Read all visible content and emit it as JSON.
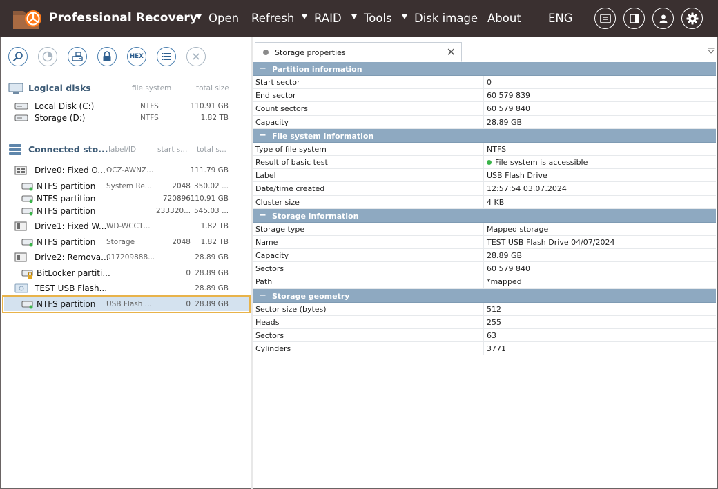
{
  "app": {
    "title": "Professional Recovery"
  },
  "menu": {
    "open": "Open",
    "refresh": "Refresh",
    "raid": "RAID",
    "tools": "Tools",
    "disk_image": "Disk image",
    "about": "About",
    "language": "ENG"
  },
  "toolbar": {
    "hex_label": "HEX"
  },
  "logical_disks": {
    "title": "Logical disks",
    "columns": [
      "file system",
      "total size"
    ],
    "items": [
      {
        "name": "Local Disk (C:)",
        "fs": "NTFS",
        "size": "110.91 GB"
      },
      {
        "name": "Storage (D:)",
        "fs": "NTFS",
        "size": "1.82 TB"
      }
    ]
  },
  "connected": {
    "title": "Connected sto...",
    "columns": [
      "label/ID",
      "start s...",
      "total s..."
    ],
    "items": [
      {
        "name": "Drive0: Fixed O...",
        "label": "OCZ-AWNZ...",
        "start": "",
        "size": "111.79 GB"
      },
      {
        "name": "NTFS partition",
        "label": "System Re...",
        "start": "2048",
        "size": "350.02 ..."
      },
      {
        "name": "NTFS partition",
        "label": "",
        "start": "720896",
        "size": "110.91 GB"
      },
      {
        "name": "NTFS partition",
        "label": "",
        "start": "233320...",
        "size": "545.03 ..."
      },
      {
        "name": "Drive1: Fixed W...",
        "label": "WD-WCC1...",
        "start": "",
        "size": "1.82 TB"
      },
      {
        "name": "NTFS partition",
        "label": "Storage",
        "start": "2048",
        "size": "1.82 TB"
      },
      {
        "name": "Drive2: Remova...",
        "label": "017209888...",
        "start": "",
        "size": "28.89 GB"
      },
      {
        "name": "BitLocker partiti...",
        "label": "",
        "start": "0",
        "size": "28.89 GB"
      },
      {
        "name": "TEST USB Flash...",
        "label": "",
        "start": "",
        "size": "28.89 GB"
      },
      {
        "name": "NTFS partition",
        "label": "USB Flash ...",
        "start": "0",
        "size": "28.89 GB"
      }
    ]
  },
  "tab": {
    "label": "Storage properties"
  },
  "properties": [
    {
      "title": "Partition information",
      "rows": [
        {
          "key": "Start sector",
          "value": "0"
        },
        {
          "key": "End sector",
          "value": "60 579 839"
        },
        {
          "key": "Count sectors",
          "value": "60 579 840"
        },
        {
          "key": "Capacity",
          "value": "28.89 GB"
        }
      ]
    },
    {
      "title": "File system information",
      "rows": [
        {
          "key": "Type of file system",
          "value": "NTFS"
        },
        {
          "key": "Result of basic test",
          "value": "File system is accessible"
        },
        {
          "key": "Label",
          "value": "USB Flash Drive"
        },
        {
          "key": "Date/time created",
          "value": "12:57:54 03.07.2024"
        },
        {
          "key": "Cluster size",
          "value": "4 KB"
        }
      ]
    },
    {
      "title": "Storage information",
      "rows": [
        {
          "key": "Storage type",
          "value": "Mapped storage"
        },
        {
          "key": "Name",
          "value": "TEST USB Flash Drive 04/07/2024"
        },
        {
          "key": "Capacity",
          "value": "28.89 GB"
        },
        {
          "key": "Sectors",
          "value": "60 579 840"
        },
        {
          "key": "Path",
          "value": "*mapped"
        }
      ]
    },
    {
      "title": "Storage geometry",
      "rows": [
        {
          "key": "Sector size (bytes)",
          "value": "512"
        },
        {
          "key": "Heads",
          "value": "255"
        },
        {
          "key": "Sectors",
          "value": "63"
        },
        {
          "key": "Cylinders",
          "value": "3771"
        }
      ]
    }
  ],
  "colors": {
    "topbar": "#3a3030",
    "group_header": "#8ea9c1",
    "selection_outline": "#e8b34a",
    "accent_blue": "#4a7fb0"
  }
}
